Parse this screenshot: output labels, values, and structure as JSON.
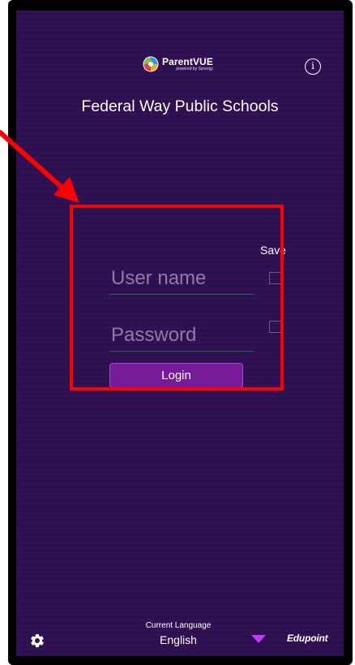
{
  "header": {
    "logo_name": "ParentVUE",
    "logo_tagline": "powered by Synergy",
    "info_icon": "info-circle-icon",
    "district_name": "Federal Way Public Schools"
  },
  "login_form": {
    "save_label": "Save",
    "username_placeholder": "User name",
    "password_placeholder": "Password",
    "save_username_checked": false,
    "save_password_checked": false,
    "login_label": "Login"
  },
  "footer": {
    "settings_icon": "gear-icon",
    "language_caption": "Current Language",
    "language_value": "English",
    "dropdown_icon": "triangle-down-icon",
    "brand": "Edupoint"
  },
  "colors": {
    "background": "#2f0f52",
    "login_button": "#761c9b",
    "dropdown_accent": "#c13cf0",
    "annotation": "#ff0000",
    "field_underline": "#1e6b48"
  }
}
